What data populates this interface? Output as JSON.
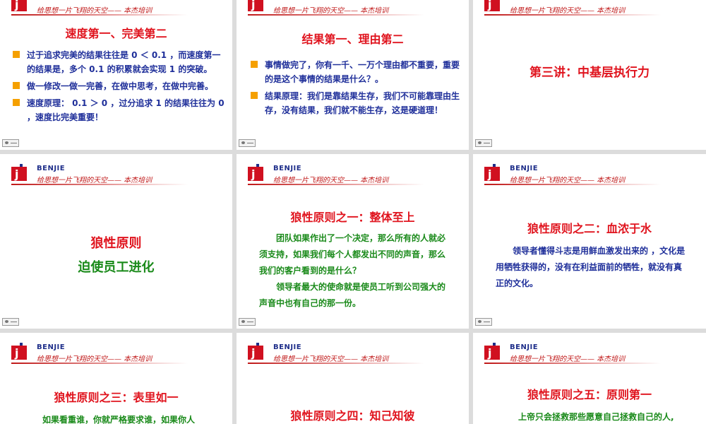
{
  "brand": {
    "name": "BENJIE",
    "tagline": "给思想一片飞翔的天空—— 本杰培训",
    "colors": {
      "red": "#e0141e",
      "blue": "#1f2f9a",
      "green": "#1a8a1a",
      "orange": "#f5a000"
    }
  },
  "slides": {
    "s1": {
      "title": "速度第一、完美第二",
      "bullets": [
        "过于追求完美的结果往往是 0 ＜ 0.1 ，而速度第一的结果是，多个 0.1 的积累就会实现 1 的突破。",
        "做一修改一做一完善，在做中思考，在做中完善。",
        "速度原理： 0.1 ＞ 0 ，过分追求 1 的结果往往为 0 ，速度比完美重要！"
      ]
    },
    "s2": {
      "title": "结果第一、理由第二",
      "bullets": [
        "事情做完了，你有一千、一万个理由都不重要，重要的是这个事情的结果是什么？。",
        "结果原理：我们是靠结果生存，我们不可能靠理由生存，没有结果，我们就不能生存，这是硬道理！"
      ]
    },
    "s3": {
      "title": "第三讲：中基层执行力"
    },
    "s4": {
      "title_line1": "狼性原则",
      "title_line2": "迫使员工进化"
    },
    "s5": {
      "title": "狼性原则之一：整体至上",
      "paragraphs": [
        "团队如果作出了一个决定，那么所有的人就必须支持，如果我们每个人都发出不同的声音，那么我们的客户看到的是什么？",
        "领导者最大的使命就是使员工听到公司强大的声音中也有自己的那一份。"
      ]
    },
    "s6": {
      "title": "狼性原则之二：血浓于水",
      "paragraphs": [
        "领导者懂得斗志是用鲜血激发出来的 ，文化是用牺牲获得的，没有在利益面前的牺牲，就没有真正的文化。"
      ]
    },
    "s7": {
      "title": "狼性原则之三：表里如一",
      "paragraphs": [
        "如果看重谁，你就严格要求谁，如果你人"
      ]
    },
    "s8": {
      "title": "狼性原则之四：知己知彼"
    },
    "s9": {
      "title": "狼性原则之五：原则第一",
      "paragraphs": [
        "上帝只会拯救那些愿意自己拯救自己的人,"
      ]
    }
  }
}
